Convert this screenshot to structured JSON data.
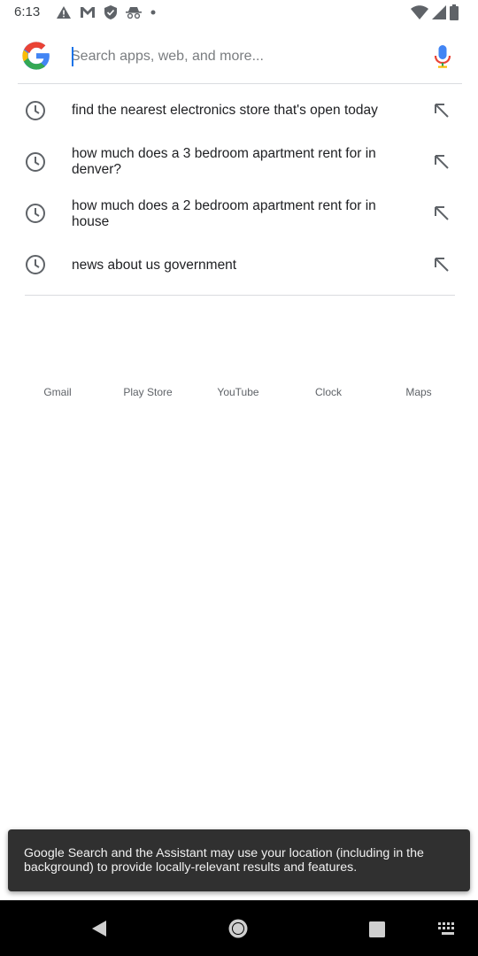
{
  "status_bar": {
    "time": "6:13",
    "left_icons": [
      "warning-icon",
      "gmail-icon",
      "shield-icon",
      "incognito-icon",
      "dot-icon"
    ],
    "right_icons": [
      "wifi-icon",
      "signal-icon",
      "battery-icon"
    ]
  },
  "search": {
    "placeholder": "Search apps, web, and more...",
    "value": "",
    "logo": "google-g-logo",
    "mic_icon": "mic-icon"
  },
  "suggestions": [
    {
      "text": "find the nearest electronics store that's open today",
      "icon": "history-clock-icon",
      "action_icon": "arrow-up-left-icon"
    },
    {
      "text": "how much does a 3 bedroom apartment rent for in denver?",
      "icon": "history-clock-icon",
      "action_icon": "arrow-up-left-icon"
    },
    {
      "text": "how much does a 2 bedroom apartment rent for in house",
      "icon": "history-clock-icon",
      "action_icon": "arrow-up-left-icon"
    },
    {
      "text": "news about us government",
      "icon": "history-clock-icon",
      "action_icon": "arrow-up-left-icon"
    }
  ],
  "apps": [
    "Gmail",
    "Play Store",
    "YouTube",
    "Clock",
    "Maps"
  ],
  "toast": {
    "text": "Google Search and the Assistant may use your location (including in the background) to provide locally-relevant results and features."
  },
  "nav_bar": {
    "buttons": [
      "back-icon",
      "home-icon",
      "recents-icon",
      "keyboard-icon"
    ]
  },
  "colors": {
    "accent": "#1a73e8",
    "google_blue": "#4285f4",
    "google_red": "#ea4335",
    "google_yellow": "#fbbc05",
    "google_green": "#34a853",
    "toast_bg": "#303030",
    "nav_bg": "#000000"
  }
}
